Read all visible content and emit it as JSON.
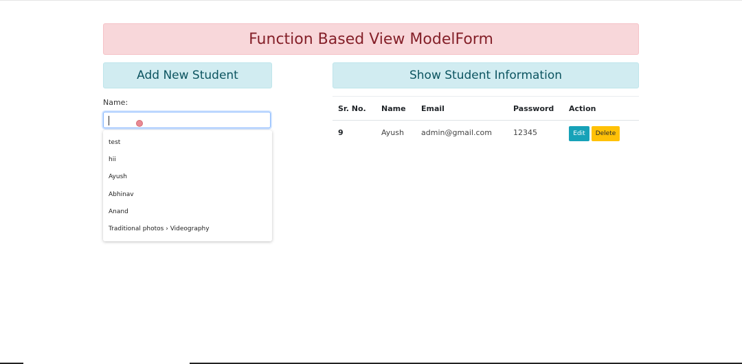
{
  "banner": {
    "title": "Function Based View ModelForm"
  },
  "left_panel": {
    "header": "Add New Student",
    "name_label": "Name:",
    "name_input": {
      "value": "",
      "placeholder": ""
    },
    "autocomplete_suggestions": [
      "test",
      "hii",
      "Ayush",
      "Abhinav",
      "Anand",
      "Traditional photos › Videography"
    ]
  },
  "right_panel": {
    "header": "Show Student Information",
    "table": {
      "columns": [
        "Sr. No.",
        "Name",
        "Email",
        "Password",
        "Action"
      ],
      "rows": [
        {
          "sr_no": "9",
          "name": "Ayush",
          "email": "admin@gmail.com",
          "password": "12345",
          "edit_label": "Edit",
          "delete_label": "Delete"
        }
      ]
    }
  },
  "colors": {
    "banner_bg": "#f8d7da",
    "banner_text": "#842029",
    "header_bg": "#d1ecf1",
    "header_text": "#0c5460",
    "edit_button": "#17a2b8",
    "delete_button": "#ffc107"
  }
}
